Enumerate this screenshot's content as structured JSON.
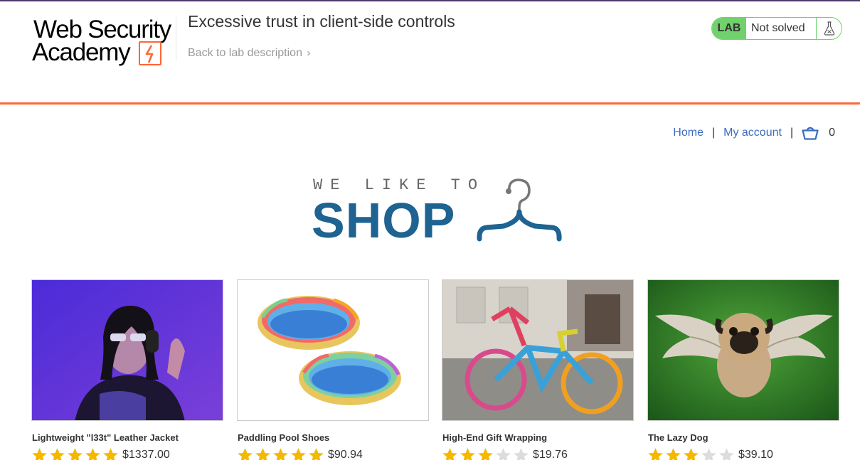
{
  "header": {
    "logo_line1": "Web Security",
    "logo_line2": "Academy",
    "lab_title": "Excessive trust in client-side controls",
    "back_link": "Back to lab description",
    "lab_badge": "LAB",
    "lab_status": "Not solved",
    "colors": {
      "accent": "#ff6633",
      "solved_green": "#70d16d",
      "link": "#3a6cc1",
      "banner_blue": "#1e6391"
    }
  },
  "nav": {
    "home": "Home",
    "separator": "|",
    "my_account": "My account",
    "cart_icon": "basket-icon",
    "cart_count": "0"
  },
  "banner": {
    "tagline": "WE LIKE TO",
    "headline": "SHOP"
  },
  "products": [
    {
      "name": "Lightweight \"l33t\" Leather Jacket",
      "rating": 5,
      "price": "$1337.00",
      "image": "woman-headphones-purple-photo"
    },
    {
      "name": "Paddling Pool Shoes",
      "rating": 5,
      "price": "$90.94",
      "image": "paddling-pools-photo"
    },
    {
      "name": "High-End Gift Wrapping",
      "rating": 3,
      "price": "$19.76",
      "image": "knitted-bicycle-photo"
    },
    {
      "name": "The Lazy Dog",
      "rating": 3,
      "price": "$39.10",
      "image": "flying-pug-photo"
    }
  ]
}
